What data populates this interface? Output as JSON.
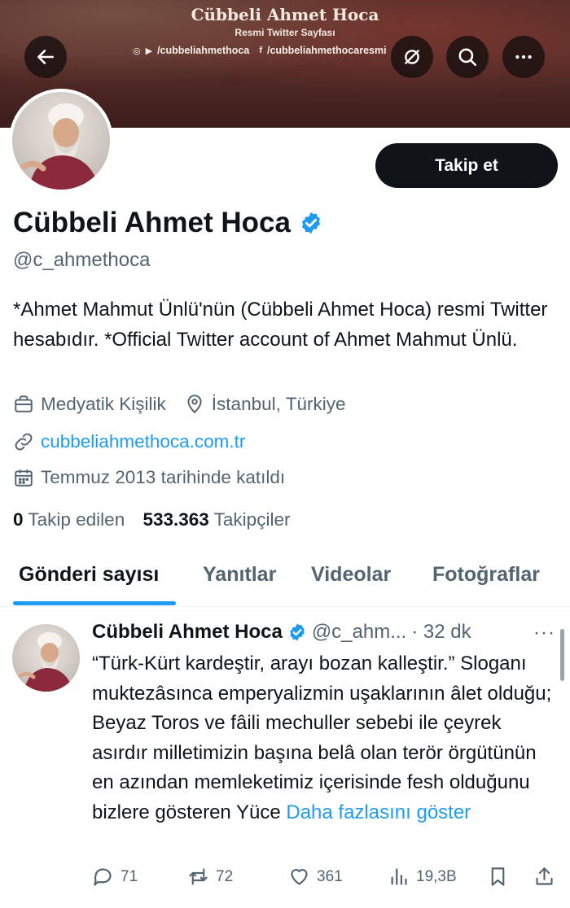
{
  "banner": {
    "title": "Cübbeli Ahmet Hoca",
    "subtitle": "Resmi Twitter Sayfası",
    "social_instagram_youtube": "/cubbeliahmethoca",
    "social_facebook": "/cubbeliahmethocaresmi"
  },
  "nav": {
    "back_icon": "arrow-left-icon",
    "grok_icon": "grok-icon",
    "search_icon": "search-icon",
    "more_icon": "more-horizontal-icon"
  },
  "profile": {
    "follow_label": "Takip et",
    "name": "Cübbeli Ahmet Hoca",
    "handle": "@c_ahmethoca",
    "bio": "*Ahmet Mahmut Ünlü'nün (Cübbeli Ahmet Hoca) resmi Twitter hesabıdır. *Official Twitter account of Ahmet Mahmut Ünlü.",
    "category": "Medyatik Kişilik",
    "location": "İstanbul, Türkiye",
    "website": "cubbeliahmethoca.com.tr",
    "joined": "Temmuz 2013 tarihinde katıldı",
    "following_count": "0",
    "following_label": "Takip edilen",
    "followers_count": "533.363",
    "followers_label": "Takipçiler"
  },
  "tabs": [
    {
      "label": "Gönderi sayısı",
      "active": true
    },
    {
      "label": "Yanıtlar",
      "active": false
    },
    {
      "label": "Videolar",
      "active": false
    },
    {
      "label": "Fotoğraflar",
      "active": false
    }
  ],
  "tweet": {
    "author": "Cübbeli Ahmet Hoca",
    "handle": "@c_ahm...",
    "time": "· 32 dk",
    "more": "···",
    "text": "“Türk-Kürt kardeştir, arayı bozan kalleştir.” Sloganı muktezâsınca emperyalizmin uşaklarının âlet olduğu; Beyaz Toros ve fâili mechuller sebebi ile çeyrek asırdır milletimizin başına belâ olan terör örgütünün en azından memleketimiz içerisinde fesh olduğunu bizlere gösteren Yüce",
    "show_more": "Daha fazlasını göster",
    "replies": "71",
    "retweets": "72",
    "likes": "361",
    "views": "19,3B"
  },
  "colors": {
    "accent": "#1d9bf0",
    "text": "#0f1419",
    "muted": "#536471",
    "verified": "#1d9bf0"
  }
}
